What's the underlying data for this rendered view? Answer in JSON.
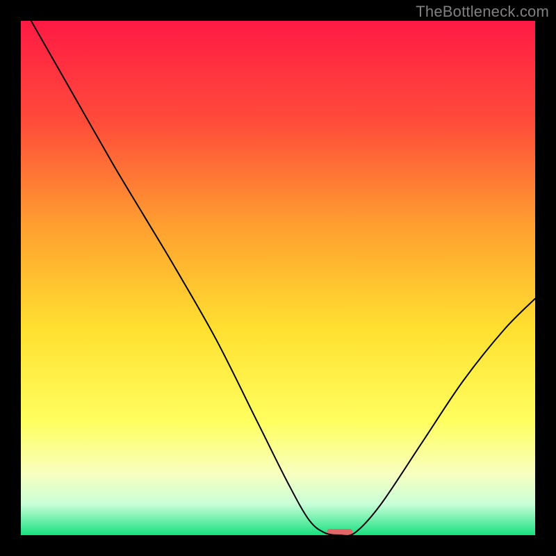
{
  "watermark": "TheBottleneck.com",
  "chart_data": {
    "type": "line",
    "title": "",
    "xlabel": "",
    "ylabel": "",
    "x_range": [
      0,
      100
    ],
    "y_range": [
      0,
      100
    ],
    "gradient_stops": [
      {
        "offset": 0,
        "color": "#ff1a44"
      },
      {
        "offset": 20,
        "color": "#ff4d3a"
      },
      {
        "offset": 40,
        "color": "#ffa030"
      },
      {
        "offset": 60,
        "color": "#ffe030"
      },
      {
        "offset": 78,
        "color": "#ffff60"
      },
      {
        "offset": 88,
        "color": "#f8ffc0"
      },
      {
        "offset": 94,
        "color": "#c8ffd8"
      },
      {
        "offset": 100,
        "color": "#18e080"
      }
    ],
    "series": [
      {
        "name": "bottleneck-curve",
        "stroke": "#000000",
        "stroke_width": 2,
        "points": [
          {
            "x": 2,
            "y": 100
          },
          {
            "x": 10,
            "y": 86
          },
          {
            "x": 18,
            "y": 72
          },
          {
            "x": 24,
            "y": 62
          },
          {
            "x": 30,
            "y": 52
          },
          {
            "x": 38,
            "y": 38
          },
          {
            "x": 46,
            "y": 22
          },
          {
            "x": 52,
            "y": 10
          },
          {
            "x": 56,
            "y": 3
          },
          {
            "x": 59,
            "y": 0.5
          },
          {
            "x": 62,
            "y": 0
          },
          {
            "x": 65,
            "y": 0.5
          },
          {
            "x": 70,
            "y": 6
          },
          {
            "x": 78,
            "y": 18
          },
          {
            "x": 86,
            "y": 30
          },
          {
            "x": 94,
            "y": 40
          },
          {
            "x": 100,
            "y": 46
          }
        ]
      }
    ],
    "marker": {
      "x": 62,
      "y": 0,
      "width": 5,
      "height": 1.2,
      "color": "#e06868",
      "rx": 4
    }
  }
}
